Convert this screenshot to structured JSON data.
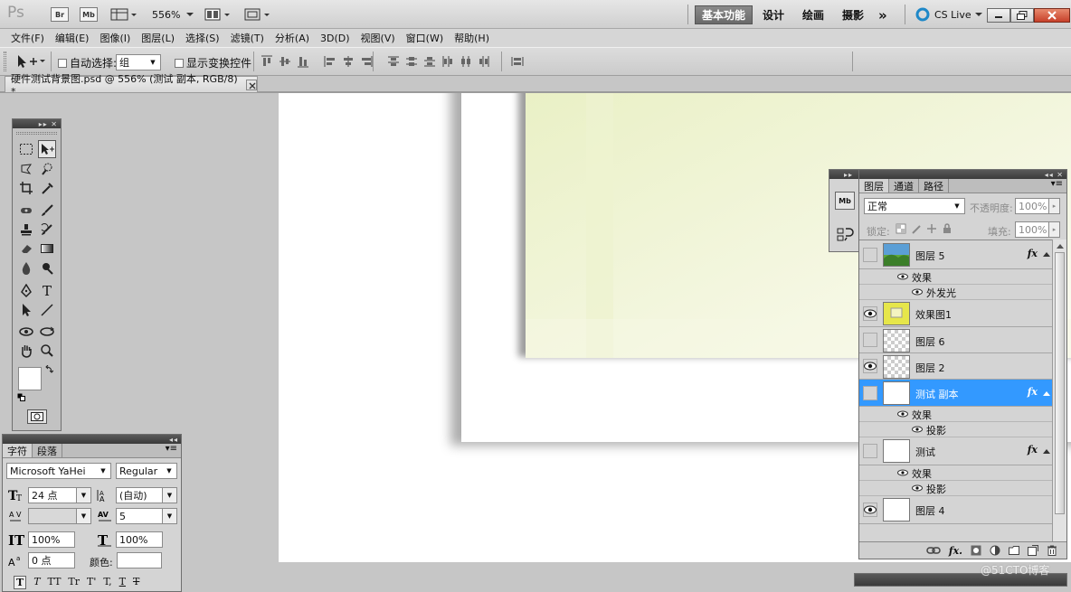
{
  "appbar": {
    "ps_logo": "Ps",
    "br_label": "Br",
    "mb_label": "Mb",
    "zoom": "556%",
    "workspaces": [
      "基本功能",
      "设计",
      "绘画",
      "摄影"
    ],
    "active_workspace": "基本功能",
    "more": "»",
    "cs_live": "CS Live"
  },
  "menu": [
    "文件(F)",
    "编辑(E)",
    "图像(I)",
    "图层(L)",
    "选择(S)",
    "滤镜(T)",
    "分析(A)",
    "3D(D)",
    "视图(V)",
    "窗口(W)",
    "帮助(H)"
  ],
  "options": {
    "auto_select_label": "自动选择:",
    "auto_select_value": "组",
    "show_transform_label": "显示变换控件"
  },
  "document": {
    "tab_title": "硬件测试背景图.psd @ 556% (测试 副本, RGB/8) *"
  },
  "char_panel": {
    "tabs": [
      "字符",
      "段落"
    ],
    "font_family": "Microsoft YaHei",
    "font_style": "Regular",
    "font_size": "24 点",
    "leading": "(自动)",
    "kerning": "",
    "tracking": "5",
    "vscale": "100%",
    "hscale": "100%",
    "baseline": "0 点",
    "color_label": "颜色:",
    "style_buttons": [
      "T",
      "T",
      "TT",
      "Tr",
      "T'",
      "T,",
      "T",
      "T"
    ]
  },
  "layers_panel": {
    "tabs": [
      "图层",
      "通道",
      "路径"
    ],
    "blend_mode": "正常",
    "opacity_label": "不透明度:",
    "opacity": "100%",
    "lock_label": "锁定:",
    "fill_label": "填充:",
    "fill": "100%",
    "layers": [
      {
        "name": "图层 5",
        "visible": false,
        "fx": "fx"
      },
      {
        "name": "效果",
        "type": "effects"
      },
      {
        "name": "外发光",
        "type": "effect"
      },
      {
        "name": "效果图1",
        "visible": true
      },
      {
        "name": "图层 6",
        "visible": false
      },
      {
        "name": "图层 2",
        "visible": true
      },
      {
        "name": "测试 副本",
        "visible": false,
        "fx": "fx",
        "selected": true
      },
      {
        "name": "效果",
        "type": "effects"
      },
      {
        "name": "投影",
        "type": "effect"
      },
      {
        "name": "测试",
        "visible": false,
        "fx": "fx"
      },
      {
        "name": "效果",
        "type": "effects"
      },
      {
        "name": "投影",
        "type": "effect"
      },
      {
        "name": "图层 4",
        "visible": true
      }
    ],
    "footer_fx": "fx."
  },
  "watermark": "@51CTO博客",
  "colors": {
    "selected_layer": "#3399ff",
    "panel_bg": "#d4d4d4",
    "canvas_bg": "#ffffff",
    "cs_live_icon": "#1e88c8"
  }
}
